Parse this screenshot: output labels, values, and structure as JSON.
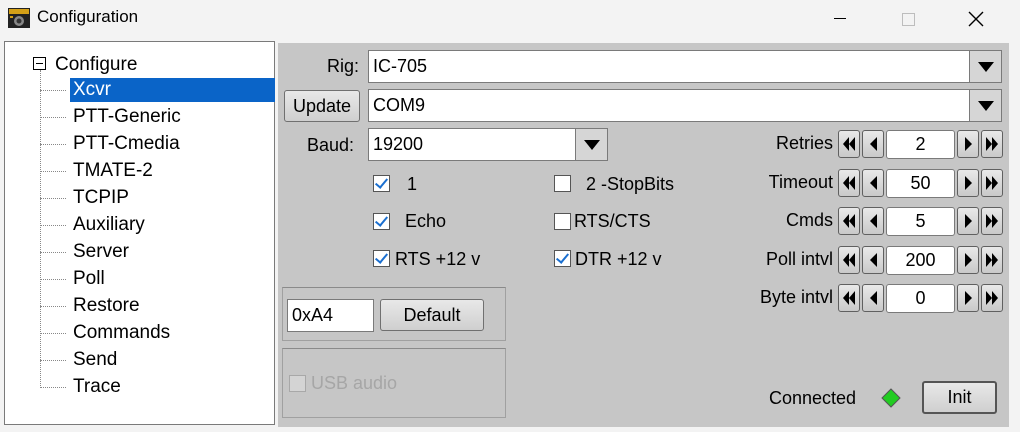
{
  "window": {
    "title": "Configuration"
  },
  "tree": {
    "root": "Configure",
    "items": [
      "Xcvr",
      "PTT-Generic",
      "PTT-Cmedia",
      "TMATE-2",
      "TCPIP",
      "Auxiliary",
      "Server",
      "Poll",
      "Restore",
      "Commands",
      "Send",
      "Trace"
    ],
    "selected": "Xcvr"
  },
  "xcvr": {
    "rig_label": "Rig:",
    "rig_value": "IC-705",
    "update_label": "Update",
    "port_value": "COM9",
    "baud_label": "Baud:",
    "baud_value": "19200",
    "checks": {
      "stop1": {
        "label": "1",
        "checked": true
      },
      "stop2": {
        "label": "2 -StopBits",
        "checked": false
      },
      "echo": {
        "label": "Echo",
        "checked": true
      },
      "rtscts": {
        "label": "RTS/CTS",
        "checked": false
      },
      "rts12": {
        "label": "RTS +12 v",
        "checked": true
      },
      "dtr12": {
        "label": "DTR +12 v",
        "checked": true
      }
    },
    "civ_address": "0xA4",
    "default_label": "Default",
    "usb_audio_label": "USB audio",
    "usb_audio_enabled": false,
    "spinners": [
      {
        "label": "Retries",
        "value": "2"
      },
      {
        "label": "Timeout",
        "value": "50"
      },
      {
        "label": "Cmds",
        "value": "5"
      },
      {
        "label": "Poll intvl",
        "value": "200"
      },
      {
        "label": "Byte intvl",
        "value": "0"
      }
    ],
    "status_label": "Connected",
    "status_color": "#22cc22",
    "init_label": "Init"
  },
  "colors": {
    "selection": "#0a64c8",
    "panel": "#c6c6c6"
  }
}
